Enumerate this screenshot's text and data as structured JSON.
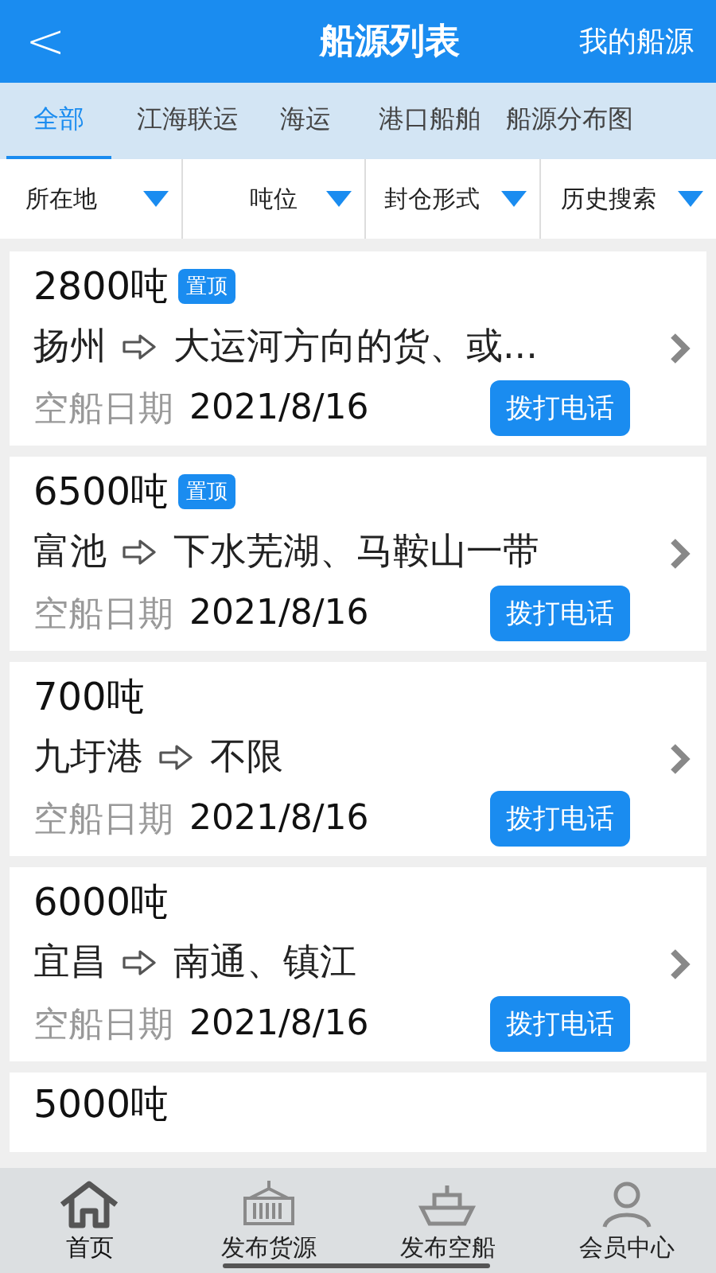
{
  "header": {
    "back": "<",
    "title": "船源列表",
    "action": "我的船源"
  },
  "tabs": [
    {
      "label": "全部",
      "selected": true
    },
    {
      "label": "江海联运",
      "selected": false
    },
    {
      "label": "海运",
      "selected": false
    },
    {
      "label": "港口船舶",
      "selected": false
    },
    {
      "label": "船源分布图",
      "selected": false
    }
  ],
  "filters": [
    "所在地",
    "吨位",
    "封仓形式",
    "历史搜索"
  ],
  "cards": [
    {
      "tonnage": "2800吨",
      "badge": "置顶",
      "from": "扬州",
      "to": "大运河方向的货、或...",
      "date_label": "空船日期",
      "date": "2021/8/16",
      "call": "拨打电话"
    },
    {
      "tonnage": "6500吨",
      "badge": "置顶",
      "from": "富池",
      "to": "下水芜湖、马鞍山一带",
      "date_label": "空船日期",
      "date": "2021/8/16",
      "call": "拨打电话"
    },
    {
      "tonnage": "700吨",
      "from": "九圩港",
      "to": "不限",
      "date_label": "空船日期",
      "date": "2021/8/16",
      "call": "拨打电话"
    },
    {
      "tonnage": "6000吨",
      "from": "宜昌",
      "to": "南通、镇江",
      "date_label": "空船日期",
      "date": "2021/8/16",
      "call": "拨打电话"
    },
    {
      "tonnage": "5000吨"
    }
  ],
  "nav": [
    {
      "kind": "home",
      "label": "首页",
      "selected": true
    },
    {
      "kind": "cargo",
      "label": "发布货源",
      "selected": false
    },
    {
      "kind": "ship",
      "label": "发布空船",
      "selected": false
    },
    {
      "kind": "member",
      "label": "会员中心",
      "selected": false
    }
  ]
}
